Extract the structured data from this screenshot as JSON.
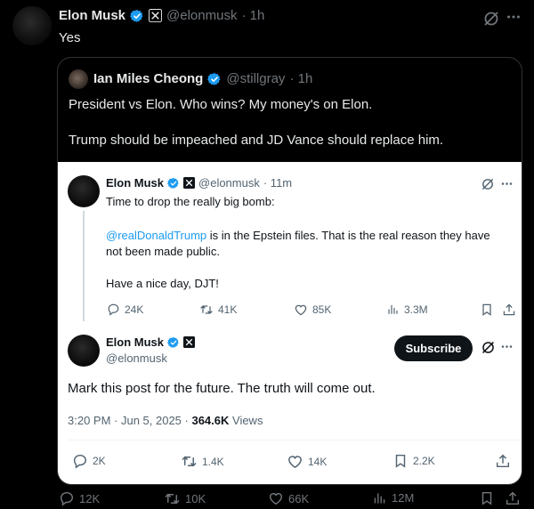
{
  "outer_post": {
    "author_name": "Elon Musk",
    "handle": "@elonmusk",
    "time": "· 1h",
    "text": "Yes",
    "actions": {
      "replies": "12K",
      "reposts": "10K",
      "likes": "66K",
      "views": "12M"
    }
  },
  "quoted_post": {
    "author_name": "Ian Miles Cheong",
    "handle": "@stillgray",
    "time": "· 1h",
    "text_line1": "President vs Elon. Who wins? My money's on Elon.",
    "text_line2": "Trump should be impeached and JD Vance should replace him."
  },
  "embedded": {
    "parent_post": {
      "author_name": "Elon Musk",
      "handle": "@elonmusk",
      "time": "· 11m",
      "text_line1": "Time to drop the really big bomb:",
      "mention": "@realDonaldTrump",
      "text_line2_rest": " is in the Epstein files. That is the real reason they have",
      "text_line3": "not been made public.",
      "text_line4": "Have a nice day, DJT!",
      "actions": {
        "replies": "24K",
        "reposts": "41K",
        "likes": "85K",
        "views": "3.3M"
      }
    },
    "main_post": {
      "author_name": "Elon Musk",
      "handle": "@elonmusk",
      "subscribe_label": "Subscribe",
      "text": "Mark this post for the future. The truth will come out.",
      "timestamp": "3:20 PM · Jun 5, 2025 · ",
      "views_count": "364.6K",
      "views_label": " Views",
      "actions": {
        "replies": "2K",
        "reposts": "1.4K",
        "likes": "14K",
        "bookmarks": "2.2K"
      }
    }
  },
  "colors": {
    "accent": "#1d9bf0",
    "background_dark": "#000000",
    "background_light": "#ffffff"
  }
}
